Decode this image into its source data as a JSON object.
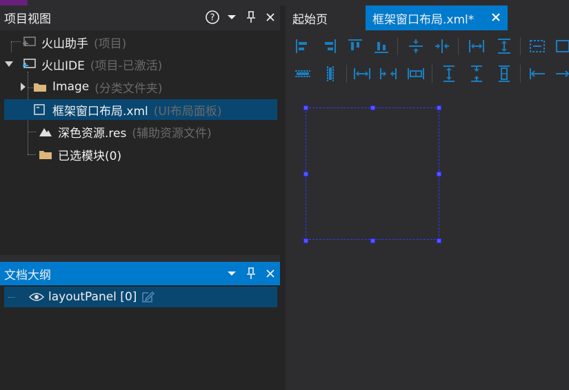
{
  "project_view": {
    "title": "项目视图",
    "tree": [
      {
        "label": "火山助手",
        "sub": "(项目)"
      },
      {
        "label": "火山IDE",
        "sub": "(项目-已激活)"
      },
      {
        "label": "Image",
        "sub": "(分类文件夹)"
      },
      {
        "label": "框架窗口布局.xml",
        "sub": "(UI布局面板)"
      },
      {
        "label": "深色资源.res",
        "sub": "(辅助资源文件)"
      },
      {
        "label": "已选模块(0)",
        "sub": ""
      }
    ]
  },
  "outline": {
    "title": "文档大纲",
    "items": [
      {
        "label": "layoutPanel [0]"
      }
    ]
  },
  "tabs": [
    {
      "label": "起始页"
    },
    {
      "label": "框架窗口布局.xml*"
    }
  ],
  "icons": {
    "help": "help-icon",
    "dropdown": "dropdown-icon",
    "pin": "pin-icon",
    "close": "close-icon",
    "eye": "eye-icon",
    "edit": "edit-icon",
    "folder": "folder-icon"
  },
  "colors": {
    "accent": "#007acc",
    "selection": "#094771",
    "folder": "#dcb67a",
    "toolbar_icon": "#1a7fc0",
    "handle": "#5555ff"
  }
}
